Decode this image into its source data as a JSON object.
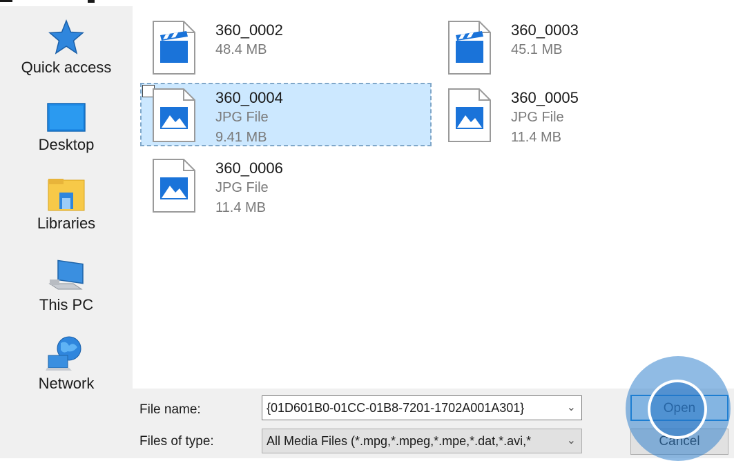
{
  "nav": {
    "items": [
      {
        "label": "Quick access",
        "icon": "star-icon"
      },
      {
        "label": "Desktop",
        "icon": "desktop-icon"
      },
      {
        "label": "Libraries",
        "icon": "libraries-icon"
      },
      {
        "label": "This PC",
        "icon": "computer-icon"
      },
      {
        "label": "Network",
        "icon": "network-icon"
      }
    ]
  },
  "files": [
    {
      "name": "360_0002",
      "type": "",
      "size": "48.4 MB",
      "icon": "video-file-icon",
      "selected": false
    },
    {
      "name": "360_0003",
      "type": "",
      "size": "45.1 MB",
      "icon": "video-file-icon",
      "selected": false
    },
    {
      "name": "360_0004",
      "type": "JPG File",
      "size": "9.41 MB",
      "icon": "image-file-icon",
      "selected": true
    },
    {
      "name": "360_0005",
      "type": "JPG File",
      "size": "11.4 MB",
      "icon": "image-file-icon",
      "selected": false
    },
    {
      "name": "360_0006",
      "type": "JPG File",
      "size": "11.4 MB",
      "icon": "image-file-icon",
      "selected": false
    }
  ],
  "form": {
    "file_name_label": "File name:",
    "file_name_value": "{01D601B0-01CC-01B8-7201-1702A001A301}",
    "file_type_label": "Files of type:",
    "file_type_value": "All Media Files (*.mpg,*.mpeg,*.mpe,*.dat,*.avi,*"
  },
  "buttons": {
    "open": "Open",
    "cancel": "Cancel"
  },
  "colors": {
    "accent": "#0078d7",
    "selection": "#cce8ff",
    "icon_blue": "#1a73d9"
  }
}
